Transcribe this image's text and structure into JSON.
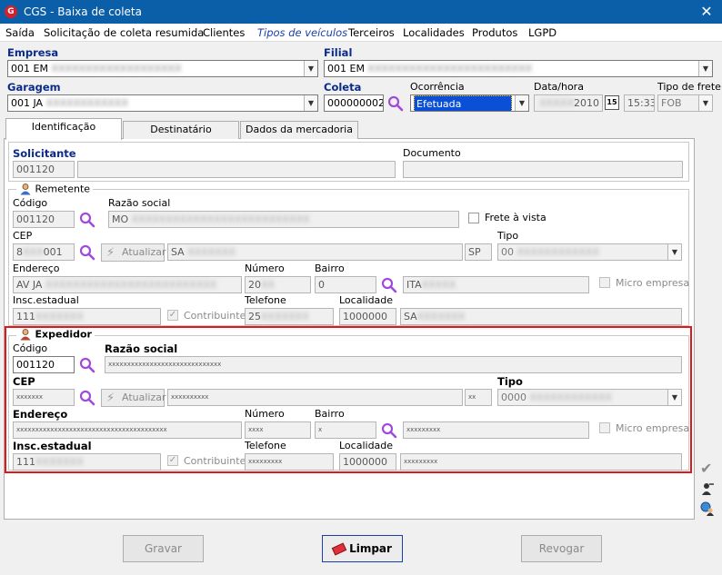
{
  "window": {
    "title": "CGS - Baixa de coleta",
    "close_glyph": "✕",
    "logo_letter": "G"
  },
  "menu": [
    "Saída",
    "Solicitação de coleta resumida",
    "Clientes",
    "Tipos de veículos",
    "Terceiros",
    "Localidades",
    "Produtos",
    "LGPD"
  ],
  "header": {
    "empresa_label": "Empresa",
    "empresa_value": "001 EM",
    "filial_label": "Filial",
    "filial_value": "001 EM",
    "garagem_label": "Garagem",
    "garagem_value": "001 JA",
    "coleta_label": "Coleta",
    "coleta_value": "000000002",
    "ocorrencia_label": "Ocorrência",
    "ocorrencia_value": "Efetuada",
    "datahora_label": "Data/hora",
    "data_value": "2010",
    "hora_value": "15:33",
    "cal_icon": "15",
    "tipofrete_label": "Tipo de frete",
    "tipofrete_value": "FOB"
  },
  "tabs": [
    "Identificação",
    "Destinatário",
    "Dados da mercadoria"
  ],
  "solicitante": {
    "label": "Solicitante",
    "codigo": "001120",
    "documento_label": "Documento"
  },
  "remetente": {
    "group_label": "Remetente",
    "codigo_label": "Código",
    "codigo": "001120",
    "razao_label": "Razão social",
    "razao": "MO",
    "frete_vista": "Frete à vista",
    "cep_label": "CEP",
    "cep": "8",
    "cep_suffix": "001",
    "atualizar": "Atualizar",
    "cidade": "SA",
    "uf": "SP",
    "tipo_label": "Tipo",
    "tipo": "00",
    "endereco_label": "Endereço",
    "endereco": "AV JA",
    "numero_label": "Número",
    "numero": "20",
    "bairro_label": "Bairro",
    "bairro": "0",
    "bairro_nome": "ITA",
    "micro_label": "Micro empresa",
    "insc_label": "Insc.estadual",
    "insc": "111",
    "contribuinte_label": "Contribuinte",
    "telefone_label": "Telefone",
    "telefone": "25",
    "localidade_label": "Localidade",
    "localidade": "1000000",
    "localidade_nome": "SA"
  },
  "expedidor": {
    "group_label": "Expedidor",
    "codigo_label": "Código",
    "codigo": "001120",
    "razao_label": "Razão social",
    "razao": "xxxxxxxxxxxxxxxxxxxxxxxxxxxxxx",
    "cep_label": "CEP",
    "cep": "xxxxxxx",
    "atualizar": "Atualizar",
    "cidade": "xxxxxxxxxx",
    "uf": "xx",
    "tipo_label": "Tipo",
    "tipo": "0000",
    "endereco_label": "Endereço",
    "endereco": "xxxxxxxxxxxxxxxxxxxxxxxxxxxxxxxxxxxxxxxx",
    "numero_label": "Número",
    "numero": "xxxx",
    "bairro_label": "Bairro",
    "bairro": "x",
    "bairro_nome": "xxxxxxxxx",
    "micro_label": "Micro empresa",
    "insc_label": "Insc.estadual",
    "insc": "111",
    "contribuinte_label": "Contribuinte",
    "telefone_label": "Telefone",
    "telefone": "xxxxxxxxx",
    "localidade_label": "Localidade",
    "localidade": "1000000",
    "localidade_nome": "xxxxxxxxx"
  },
  "buttons": {
    "gravar": "Gravar",
    "limpar": "Limpar",
    "revogar": "Revogar"
  },
  "colors": {
    "titlebar": "#0b5ea8",
    "highlight_border": "#e0181c",
    "search_icon": "#a04bd8",
    "label_blue": "#0b2a8a"
  }
}
